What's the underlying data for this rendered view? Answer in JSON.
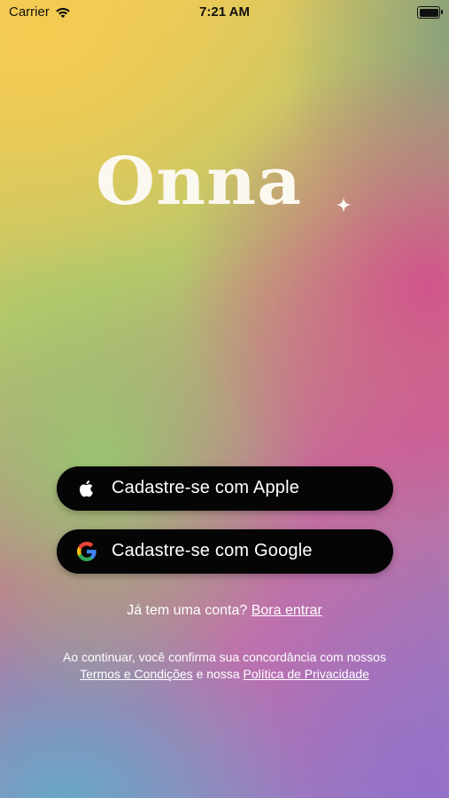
{
  "status_bar": {
    "carrier": "Carrier",
    "time": "7:21 AM"
  },
  "logo": {
    "text": "Onna"
  },
  "buttons": {
    "apple_label": "Cadastre-se com Apple",
    "google_label": "Cadastre-se com Google"
  },
  "login": {
    "prompt": "Já tem uma conta?",
    "link": "Bora entrar"
  },
  "terms": {
    "line1": "Ao continuar, você confirma sua concordância com nossos",
    "terms_link": "Termos e Condições",
    "connector": "e nossa",
    "privacy_link": "Política de Privacidade"
  },
  "icons": {
    "apple": "apple-icon",
    "google": "google-icon",
    "wifi": "wifi-icon",
    "battery": "battery-icon",
    "sparkle": "sparkle-icon"
  },
  "colors": {
    "button_bg": "#050505",
    "logo": "#fbf8ef",
    "text_light": "#ffffff"
  }
}
